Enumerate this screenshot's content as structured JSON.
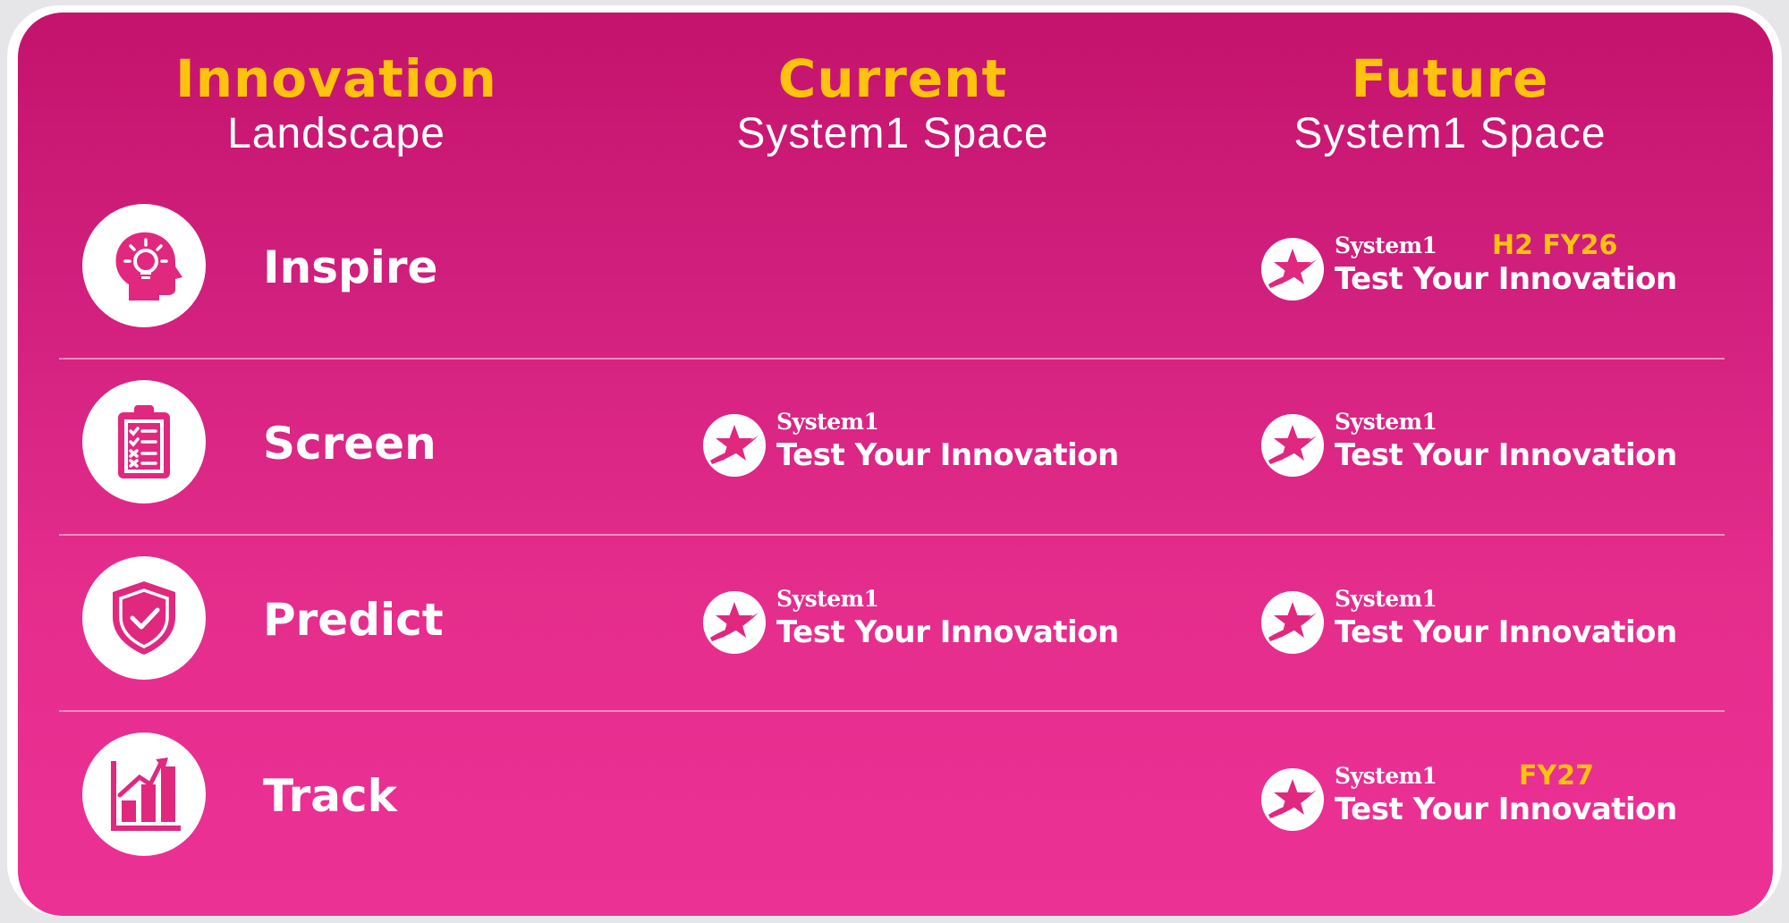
{
  "headers": [
    {
      "title": "Innovation",
      "subtitle": "Landscape"
    },
    {
      "title": "Current",
      "subtitle": "System1 Space"
    },
    {
      "title": "Future",
      "subtitle": "System1 Space"
    }
  ],
  "rows": [
    {
      "label": "Inspire",
      "icon": "head-lightbulb-icon",
      "current": null,
      "future": {
        "brand": "System1",
        "product": "Test Your Innovation",
        "tag": "H2 FY26"
      }
    },
    {
      "label": "Screen",
      "icon": "clipboard-checklist-icon",
      "current": {
        "brand": "System1",
        "product": "Test Your Innovation"
      },
      "future": {
        "brand": "System1",
        "product": "Test Your Innovation"
      }
    },
    {
      "label": "Predict",
      "icon": "shield-check-icon",
      "current": {
        "brand": "System1",
        "product": "Test Your Innovation"
      },
      "future": {
        "brand": "System1",
        "product": "Test Your Innovation"
      }
    },
    {
      "label": "Track",
      "icon": "growth-chart-icon",
      "current": null,
      "future": {
        "brand": "System1",
        "product": "Test Your Innovation",
        "tag": "FY27"
      }
    }
  ],
  "colors": {
    "background": "#d11f7d",
    "accent": "#ffc20e",
    "text": "#ffffff",
    "divider": "#f28cc0"
  }
}
